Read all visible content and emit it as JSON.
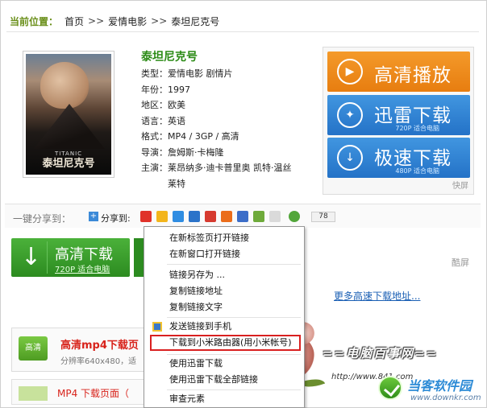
{
  "breadcrumb": {
    "label": "当前位置：",
    "items": [
      "首页",
      "爱情电影",
      "泰坦尼克号"
    ],
    "separator": ">>"
  },
  "poster": {
    "caption_en": "TITANIC",
    "caption_cn": "泰坦尼克号"
  },
  "movie": {
    "title": "泰坦尼克号",
    "rows": [
      {
        "k": "类型：",
        "v": "爱情电影 剧情片"
      },
      {
        "k": "年份：",
        "v": "1997"
      },
      {
        "k": "地区：",
        "v": "欧美"
      },
      {
        "k": "语言：",
        "v": "英语"
      },
      {
        "k": "格式：",
        "v": "MP4 / 3GP / 高清"
      },
      {
        "k": "导演：",
        "v": "詹姆斯·卡梅隆"
      },
      {
        "k": "主演：",
        "v": "莱昂纳多·迪卡普里奥 凯特·温丝"
      },
      {
        "k": "",
        "v": "莱特"
      }
    ]
  },
  "buttons": {
    "play": "高清播放",
    "xunlei": "迅雷下载",
    "xunlei_sub": "720P 适合电脑",
    "fast": "极速下载",
    "fast_sub": "480P 适合电脑",
    "kp": "快屏"
  },
  "share": {
    "label": "一键分享到：",
    "to": "分享到:",
    "count": "78"
  },
  "green_button": {
    "title": "高清下载",
    "sub": "720P 适合电脑"
  },
  "kupin": "酷屏",
  "more_link": "更多高速下载地址...",
  "mp4": {
    "icon": "高清",
    "title": "高清mp4下载页",
    "sub": "分辨率640x480，适",
    "title2": "MP4 下载页面（"
  },
  "context_menu": {
    "items": [
      "在新标签页打开链接",
      "在新窗口打开链接",
      "链接另存为 ...",
      "复制链接地址",
      "复制链接文字",
      "发送链接到手机",
      "下载到小米路由器(用小米帐号)",
      "使用迅雷下载",
      "使用迅雷下载全部链接",
      "审查元素"
    ]
  },
  "watermark": {
    "line1": "==电脑百事网==",
    "line2": "http://www.841.com",
    "brand": "当客软件园",
    "brand_url": "www.downkr.com"
  },
  "colors": {
    "green_title": "#2a8a14",
    "orange": "#e77d10",
    "blue": "#2472c7",
    "highlight_red": "#d92020"
  }
}
